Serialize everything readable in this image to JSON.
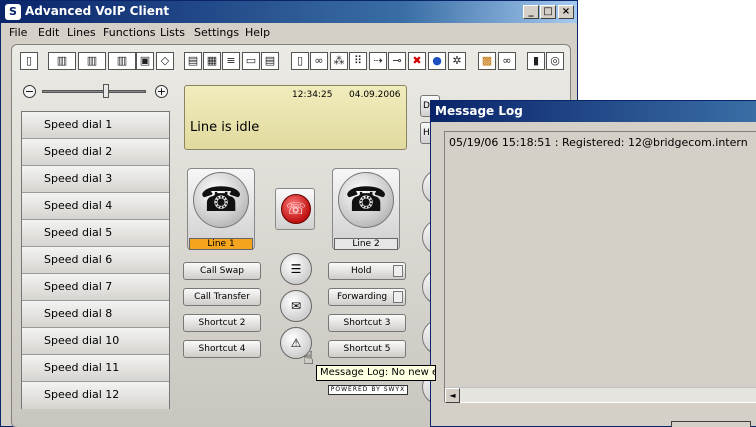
{
  "window": {
    "title": "Advanced VoIP Client",
    "minimize": "_",
    "maximize": "□",
    "close": "×"
  },
  "menu": {
    "items": [
      "File",
      "Edit",
      "Lines",
      "Functions",
      "Lists",
      "Settings",
      "Help"
    ]
  },
  "toolbar": {
    "icons": [
      "phone-book-icon",
      "line-select-icon",
      "line-select-2-icon",
      "line-select-3-icon",
      "contact-card-icon",
      "eraser-icon",
      "window-icon",
      "list-view-icon",
      "detail-view-icon",
      "card-view-icon",
      "tile-view-icon",
      "note-icon",
      "conference-icon",
      "transfer-icon",
      "dialpad-icon",
      "forward-icon",
      "connect-icon",
      "delete-icon",
      "info-icon",
      "settings-icon",
      "present-icon",
      "pickup-icon",
      "microphone-icon",
      "speaker-icon"
    ]
  },
  "volume": {
    "level": 0.62
  },
  "speed_dials": [
    "Speed dial 1",
    "Speed dial 2",
    "Speed dial 3",
    "Speed dial 4",
    "Speed dial 5",
    "Speed dial 6",
    "Speed dial 7",
    "Speed dial 8",
    "Speed dial 10",
    "Speed dial 11",
    "Speed dial 12"
  ],
  "display": {
    "time": "12:34:25",
    "date": "04.09.2006",
    "status": "Line is idle"
  },
  "lines": [
    {
      "label": "Line 1",
      "active_color": "#f4a41d"
    },
    {
      "label": "Line 2"
    }
  ],
  "buttons": {
    "call_swap": "Call Swap",
    "call_transfer": "Call Transfer",
    "shortcut2": "Shortcut 2",
    "shortcut4": "Shortcut 4",
    "hold": "Hold",
    "forwarding": "Forwarding",
    "shortcut3": "Shortcut 3",
    "shortcut5": "Shortcut 5"
  },
  "side_edge": {
    "di": "Di",
    "hi": "Hi"
  },
  "powered_by": "POWERED BY SWYX",
  "tooltip": "Message Log: No new e",
  "message_log": {
    "title": "Message Log",
    "entries": [
      "05/19/06 15:18:51 : Registered: 12@bridgecom.intern"
    ],
    "scroll_left": "◄"
  }
}
